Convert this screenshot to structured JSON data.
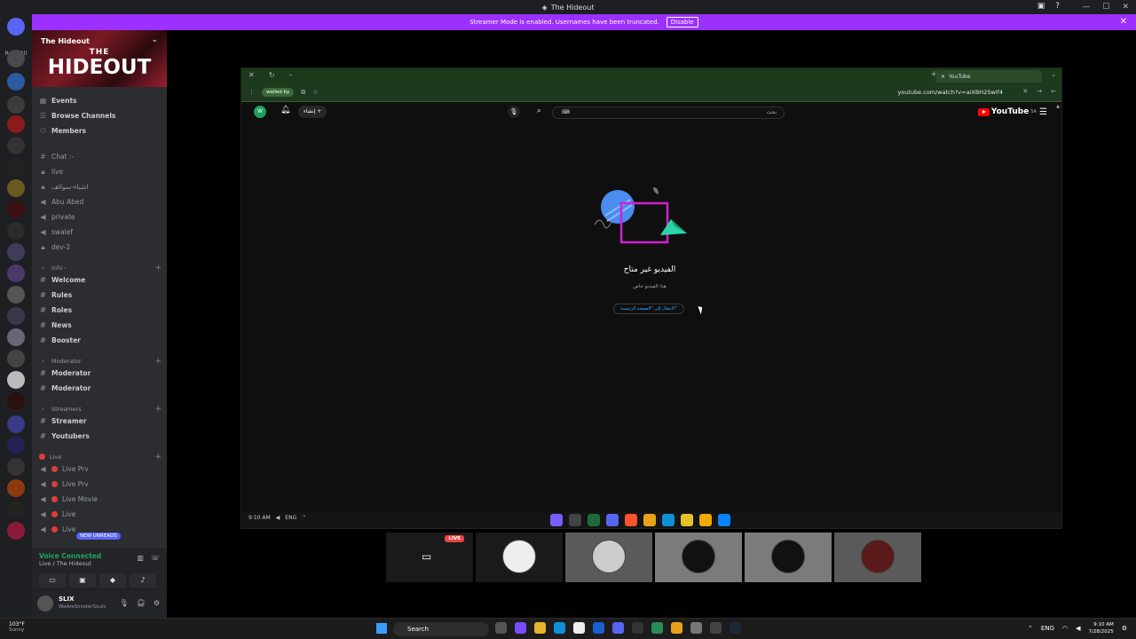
{
  "window": {
    "title": "The Hideout"
  },
  "banner": {
    "text": "Streamer Mode is enabled. Usernames have been truncated.",
    "button": "Disable"
  },
  "serverbar": {
    "read_all": "Read All"
  },
  "server": {
    "name": "The Hideout",
    "banner_top": "THE",
    "banner_main": "HIDEOUT"
  },
  "channels": {
    "events": "Events",
    "browse": "Browse Channels",
    "members": "Members",
    "items": [
      {
        "label": "Chat :-",
        "icon": "#"
      },
      {
        "label": "live",
        "icon": "lock"
      },
      {
        "label": "اشياء-سوالف",
        "icon": "lock"
      },
      {
        "label": "Abu Abed",
        "icon": "speaker"
      },
      {
        "label": "private",
        "icon": "speaker"
      },
      {
        "label": "swalef",
        "icon": "speaker"
      },
      {
        "label": "dev-2",
        "icon": "lock"
      }
    ],
    "info_category": "Info -",
    "info_items": [
      "Welcome",
      "Rules",
      "Roles",
      "News",
      "Booster"
    ],
    "mod_category": "Moderator",
    "mod_items": [
      "Moderator",
      "Moderator"
    ],
    "streamers_category": "Streamers",
    "streamer_items": [
      "Streamer",
      "Youtubers"
    ],
    "live_category": "Live",
    "live_items": [
      "Live Prv",
      "Live Prv",
      "Live Movie",
      "Live",
      "Live"
    ]
  },
  "new_unreads": "NEW UNREADS",
  "voice": {
    "status": "Voice Connected",
    "channel": "Live / The Hideout"
  },
  "user": {
    "name": "SLIX",
    "status": "WeAreSinisterSouls"
  },
  "browser": {
    "tab_title": "YouTube",
    "profile_pill": "walled by",
    "url": "youtube.com/watch?v=aiXBH2Swif4"
  },
  "youtube": {
    "logo_text": "YouTube",
    "logo_region": "SA",
    "search_placeholder": "بحث",
    "create_label": "إنشاء",
    "account_initial": "W",
    "unavailable_title": "الفيديو غير متاح",
    "unavailable_sub": "هذا الفيديو خاص",
    "home_button": "الانتقال إلى \"الصفحة الرئيسية\""
  },
  "browser_taskbar": {
    "time": "9:10 AM",
    "lang": "ENG"
  },
  "stream": {
    "live_label": "LIVE"
  },
  "taskbar": {
    "weather_temp": "103°F",
    "weather_desc": "Sunny",
    "search": "Search",
    "lang": "ENG",
    "time": "9:10 AM",
    "date": "7/28/2025"
  }
}
